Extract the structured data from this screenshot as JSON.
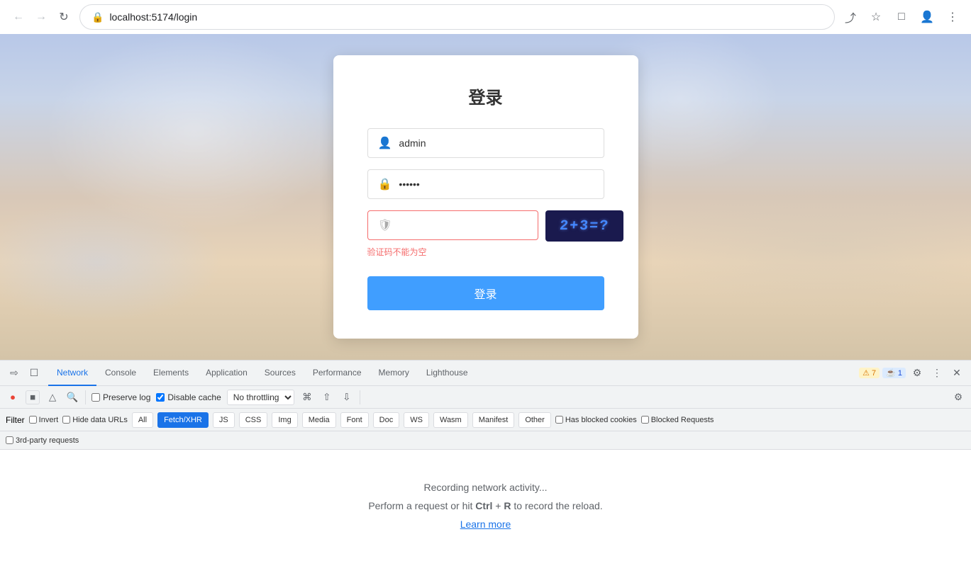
{
  "browser": {
    "url": "localhost:5174/login",
    "back_btn": "←",
    "forward_btn": "→",
    "refresh_btn": "↻"
  },
  "login": {
    "title": "登录",
    "username_placeholder": "",
    "username_value": "admin",
    "password_value": "123456",
    "captcha_value": "",
    "captcha_image_text": "2+3=?",
    "error_message": "验证码不能为空",
    "submit_label": "登录"
  },
  "devtools": {
    "tabs": [
      {
        "id": "network",
        "label": "Network",
        "active": true
      },
      {
        "id": "console",
        "label": "Console",
        "active": false
      },
      {
        "id": "elements",
        "label": "Elements",
        "active": false
      },
      {
        "id": "application",
        "label": "Application",
        "active": false
      },
      {
        "id": "sources",
        "label": "Sources",
        "active": false
      },
      {
        "id": "performance",
        "label": "Performance",
        "active": false
      },
      {
        "id": "memory",
        "label": "Memory",
        "active": false
      },
      {
        "id": "lighthouse",
        "label": "Lighthouse",
        "active": false
      }
    ],
    "warning_count": "7",
    "info_count": "1"
  },
  "network": {
    "preserve_log_label": "Preserve log",
    "disable_cache_label": "Disable cache",
    "throttle_value": "No throttling",
    "filter_label": "Filter",
    "invert_label": "Invert",
    "hide_data_urls_label": "Hide data URLs",
    "all_label": "All",
    "fetch_xhr_label": "Fetch/XHR",
    "js_label": "JS",
    "css_label": "CSS",
    "img_label": "Img",
    "media_label": "Media",
    "font_label": "Font",
    "doc_label": "Doc",
    "ws_label": "WS",
    "wasm_label": "Wasm",
    "manifest_label": "Manifest",
    "other_label": "Other",
    "has_blocked_cookies_label": "Has blocked cookies",
    "blocked_requests_label": "Blocked Requests",
    "third_party_label": "3rd-party requests",
    "recording_text": "Recording network activity...",
    "perform_text_before": "Perform a request or hit",
    "perform_text_key": "Ctrl + R",
    "perform_text_after": "to record the reload.",
    "learn_more_label": "Learn more"
  }
}
